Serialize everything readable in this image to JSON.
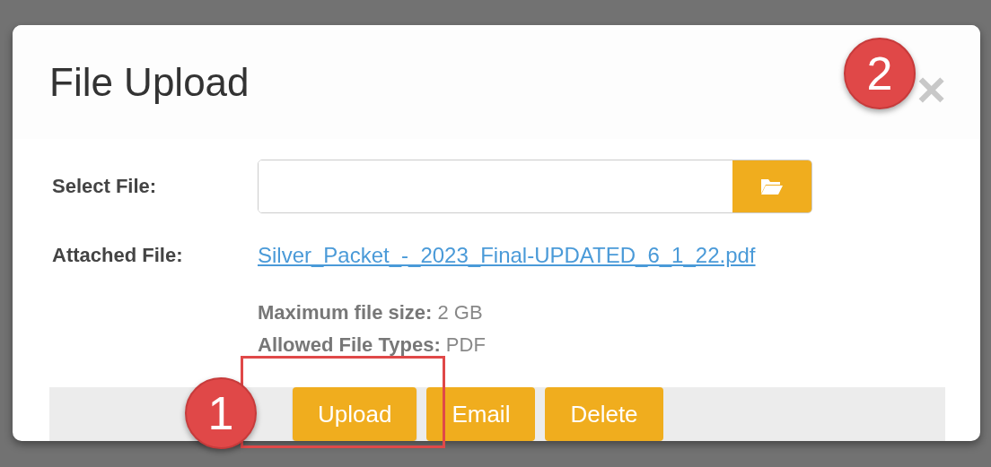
{
  "dialog": {
    "title": "File Upload",
    "close": "×"
  },
  "select_file": {
    "label": "Select File:"
  },
  "attached_file": {
    "label": "Attached File:",
    "link": "Silver_Packet_-_2023_Final-UPDATED_6_1_22.pdf"
  },
  "info": [
    "**Maximum file size:** 2 GB",
    "**Allowed File Types:** PDF"
  ],
  "buttons": [
    {
      "label": "Upload",
      "highlighted": true
    },
    {
      "label": "Email",
      "highlighted": false
    },
    {
      "label": "Delete",
      "highlighted": false
    }
  ],
  "callouts": [
    "1",
    "2"
  ]
}
